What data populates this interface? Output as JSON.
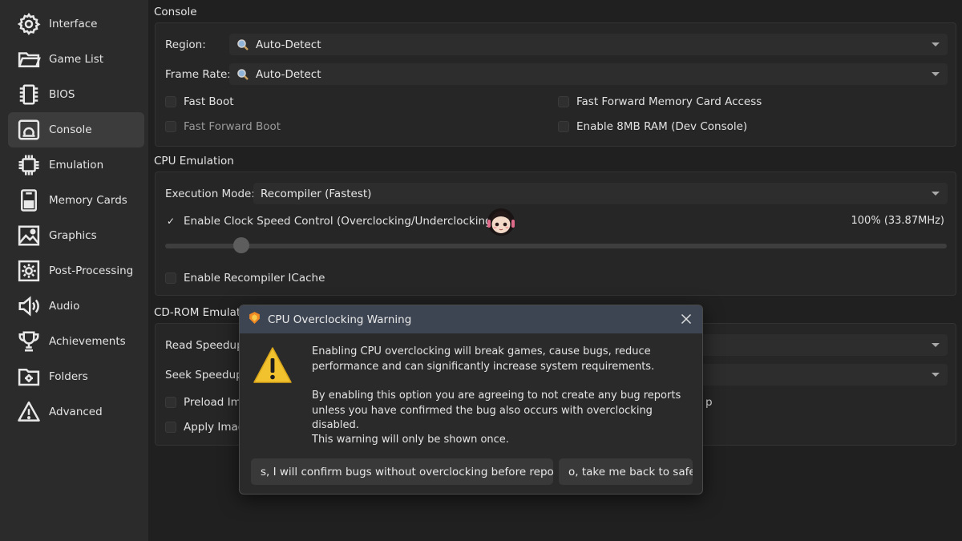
{
  "sidebar": {
    "items": [
      {
        "label": "Interface",
        "icon": "gear-icon"
      },
      {
        "label": "Game List",
        "icon": "folder-icon"
      },
      {
        "label": "BIOS",
        "icon": "chip-icon"
      },
      {
        "label": "Console",
        "icon": "console-icon",
        "active": true
      },
      {
        "label": "Emulation",
        "icon": "cpu-icon"
      },
      {
        "label": "Memory Cards",
        "icon": "memory-card-icon"
      },
      {
        "label": "Graphics",
        "icon": "image-icon"
      },
      {
        "label": "Post-Processing",
        "icon": "sun-icon"
      },
      {
        "label": "Audio",
        "icon": "speaker-icon"
      },
      {
        "label": "Achievements",
        "icon": "trophy-icon"
      },
      {
        "label": "Folders",
        "icon": "folder-gear-icon"
      },
      {
        "label": "Advanced",
        "icon": "warning-icon"
      }
    ]
  },
  "console": {
    "title": "Console",
    "region_label": "Region:",
    "region_value": "Auto-Detect",
    "framerate_label": "Frame Rate:",
    "framerate_value": "Auto-Detect",
    "fast_boot": "Fast Boot",
    "fast_forward_boot": "Fast Forward Boot",
    "ff_memcard": "Fast Forward Memory Card Access",
    "enable_8mb": "Enable 8MB RAM (Dev Console)"
  },
  "cpu": {
    "title": "CPU Emulation",
    "exec_label": "Execution Mode:",
    "exec_value": "Recompiler (Fastest)",
    "clock_check_mark": "✓",
    "clock_label": "Enable Clock Speed Control (Overclocking/Underclocking)",
    "clock_value": "100% (33.87MHz)",
    "clock_percent": 100,
    "icache": "Enable Recompiler ICache"
  },
  "cdrom": {
    "title": "CD-ROM Emulati",
    "read_label": "Read Speedup:",
    "seek_label": "Seek Speedup:",
    "preload": "Preload Ima",
    "apply": "Apply Imag",
    "right_fragment": "p"
  },
  "dialog": {
    "title": "CPU Overclocking Warning",
    "para1": "Enabling CPU overclocking will break games, cause bugs, reduce performance and can significantly increase system requirements.",
    "para2": "By enabling this option you are agreeing to not create any bug reports unless you have confirmed the bug also occurs with overclocking disabled.",
    "para3": "This warning will only be shown once.",
    "btn_confirm": "s, I will confirm bugs without overclocking before reportir",
    "btn_back": "o, take me back to safet"
  },
  "colors": {
    "accent_warning": "#f2c12e",
    "titlebar": "#3d4452"
  }
}
